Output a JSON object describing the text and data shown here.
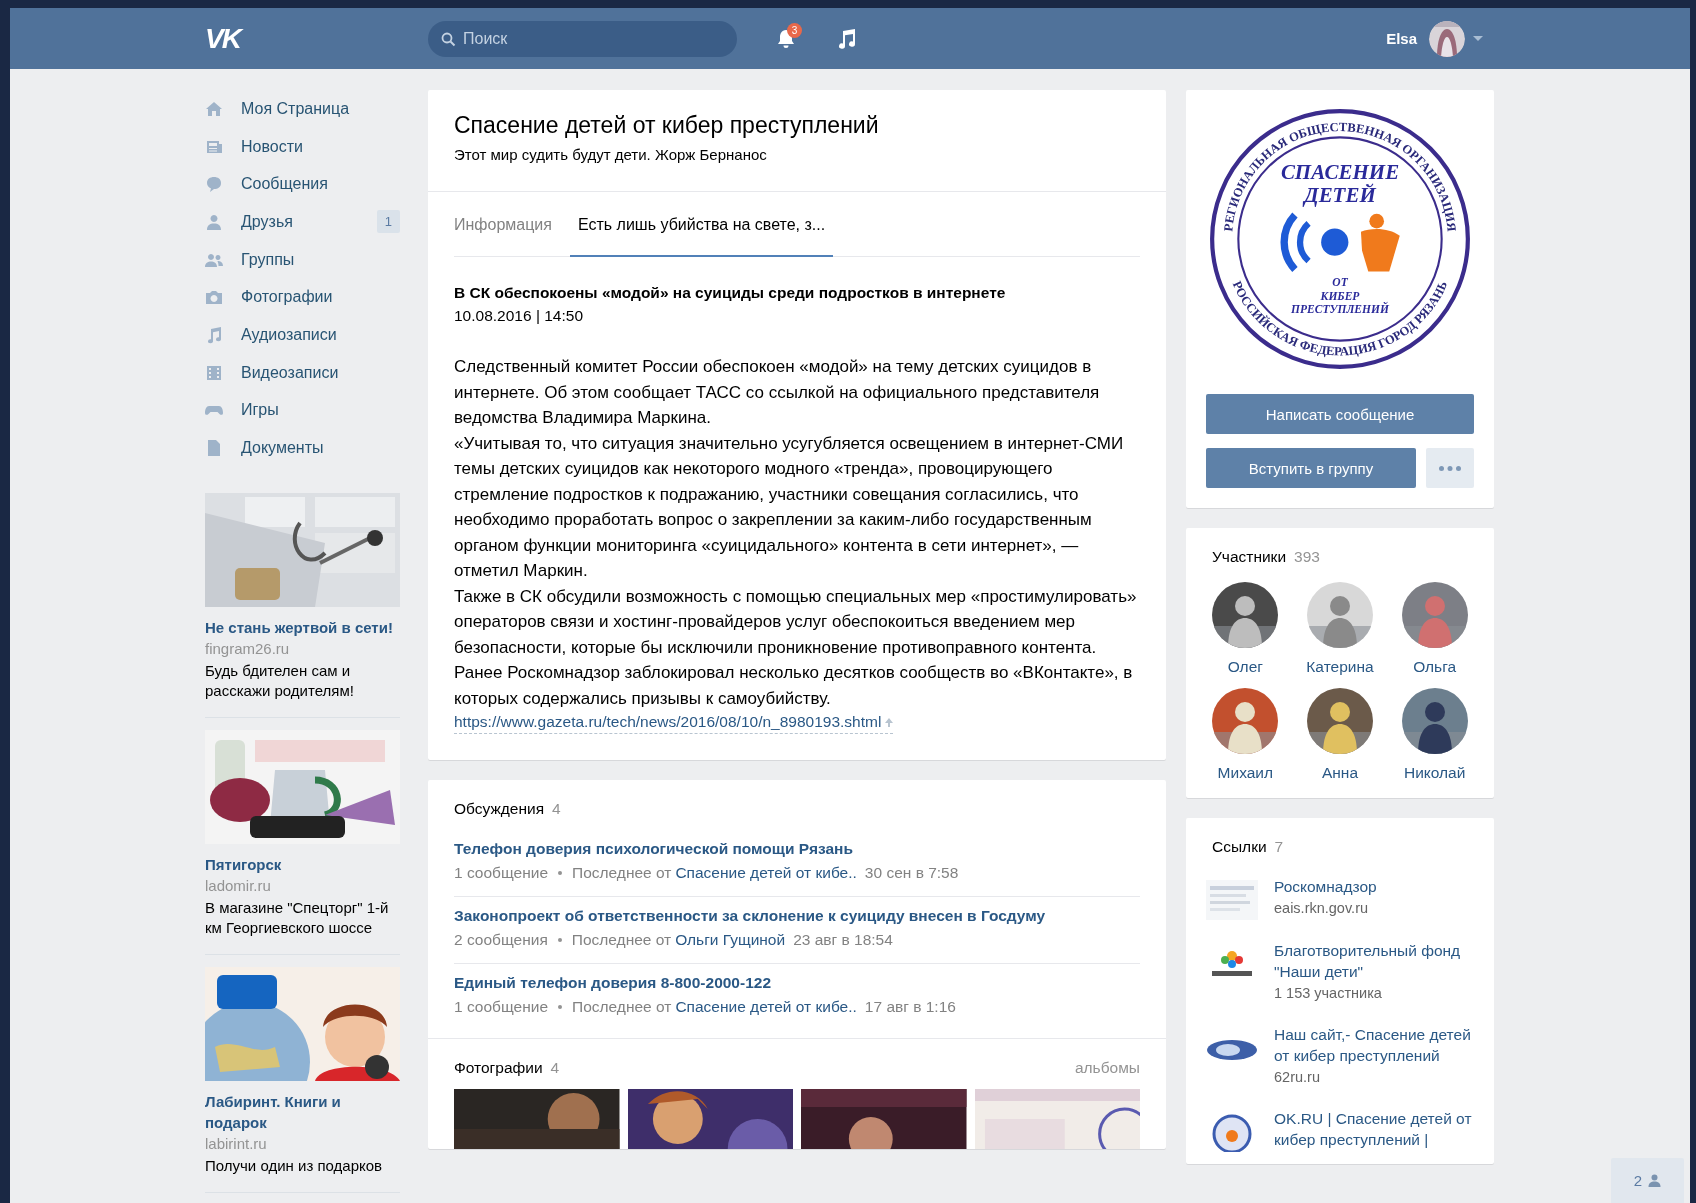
{
  "header": {
    "logo": "VK",
    "search": {
      "placeholder": "Поиск"
    },
    "notifications": "3",
    "user_name": "Elsa"
  },
  "nav": [
    {
      "label": "Моя Страница"
    },
    {
      "label": "Новости"
    },
    {
      "label": "Сообщения"
    },
    {
      "label": "Друзья",
      "badge": "1"
    },
    {
      "label": "Группы"
    },
    {
      "label": "Фотографии"
    },
    {
      "label": "Аудиозаписи"
    },
    {
      "label": "Видеозаписи"
    },
    {
      "label": "Игры"
    },
    {
      "label": "Документы"
    }
  ],
  "ads": [
    {
      "title": "Не стань жертвой в сети!",
      "domain": "fingram26.ru",
      "text": "Будь бдителен сам и расскажи родителям!"
    },
    {
      "title": "Пятигорск",
      "domain": "ladomir.ru",
      "text": "В магазине \"Спецторг\" 1-й км Георгиевского шоссе"
    },
    {
      "title": "Лабиринт. Книги и подарок",
      "domain": "labirint.ru",
      "text": "Получи один из подарков"
    }
  ],
  "group": {
    "title": "Спасение детей от кибер преступлений",
    "status": "Этот мир судить будут дети. Жорж Бернанос",
    "tabs": [
      {
        "label": "Информация",
        "selected": false
      },
      {
        "label": "Есть лишь убийства на свете, з...",
        "selected": true
      }
    ],
    "post": {
      "title": "В СК обеспокоены «модой» на суициды среди подростков в интернете",
      "date": "10.08.2016 | 14:50",
      "paragraphs": [
        "Следственный комитет России обеспокоен «модой» на тему детских суицидов в интернете. Об этом сообщает ТАСС со ссылкой на официального представителя ведомства Владимира Маркина.",
        "«Учитывая то, что ситуация значительно усугубляется освещением в интернет-СМИ темы детских суицидов как некоторого модного «тренда», провоцирующего стремление подростков к подражанию, участники совещания согласились, что необходимо проработать вопрос о закреплении за каким-либо государственным органом функции мониторинга «суицидального» контента в сети интернет», — отметил Маркин.",
        "Также в СК обсудили возможность с помощью специальных мер «простимулировать» операторов связи и хостинг-провайдеров услуг обеспокоиться введением мер безопасности, которые бы исключили проникновение противоправного контента.",
        "Ранее Роскомнадзор заблокировал несколько десятков сообществ во «ВКонтакте», в которых содержались призывы к самоубийству."
      ],
      "link": "https://www.gazeta.ru/tech/news/2016/08/10/n_8980193.shtml"
    }
  },
  "discussions": {
    "title": "Обсуждения",
    "count": "4",
    "topics": [
      {
        "title": "Телефон доверия психологической помощи Рязань",
        "messages": "1 сообщение",
        "last_label": "Последнее от",
        "author": "Спасение детей от кибе..",
        "time": "30 сен в 7:58"
      },
      {
        "title": "Законопроект об ответственности за склонение к суициду внесен в Госдуму",
        "messages": "2 сообщения",
        "last_label": "Последнее от",
        "author": "Ольги Гущиной",
        "time": "23 авг в 18:54"
      },
      {
        "title": "Единый телефон доверия 8-800-2000-122",
        "messages": "1 сообщение",
        "last_label": "Последнее от",
        "author": "Спасение детей от кибе..",
        "time": "17 авг в 1:16"
      }
    ]
  },
  "photos": {
    "title": "Фотографии",
    "count": "4",
    "albums": "альбомы"
  },
  "emblem": {
    "ring_top": "РЕГИОНАЛЬНАЯ ОБЩЕСТВЕННАЯ ОРГАНИЗАЦИЯ",
    "ring_bottom": "РОССИЙСКАЯ ФЕДЕРАЦИЯ ГОРОД РЯЗАНЬ",
    "title_lines": [
      "СПАСЕНИЕ",
      "ДЕТЕЙ"
    ],
    "sub_lines": [
      "ОТ",
      "КИБЕР",
      "ПРЕСТУПЛЕНИЙ"
    ]
  },
  "actions": {
    "message": "Написать сообщение",
    "join": "Вступить в группу"
  },
  "members": {
    "title": "Участники",
    "count": "393",
    "people": [
      {
        "name": "Олег"
      },
      {
        "name": "Катерина"
      },
      {
        "name": "Ольга"
      },
      {
        "name": "Михаил"
      },
      {
        "name": "Анна"
      },
      {
        "name": "Николай"
      }
    ]
  },
  "links": {
    "title": "Ссылки",
    "count": "7",
    "items": [
      {
        "title": "Роскомнадзор",
        "subtitle": "eais.rkn.gov.ru"
      },
      {
        "title": "Благотворительный фонд \"Наши дети\"",
        "subtitle": "1 153 участника"
      },
      {
        "title": "Наш сайт,- Спасение детей от кибер преступлений",
        "subtitle": "62ru.ru"
      },
      {
        "title": "OK.RU | Спасение детей от кибер преступлений |"
      }
    ]
  },
  "chat_bar": {
    "count": "2"
  }
}
